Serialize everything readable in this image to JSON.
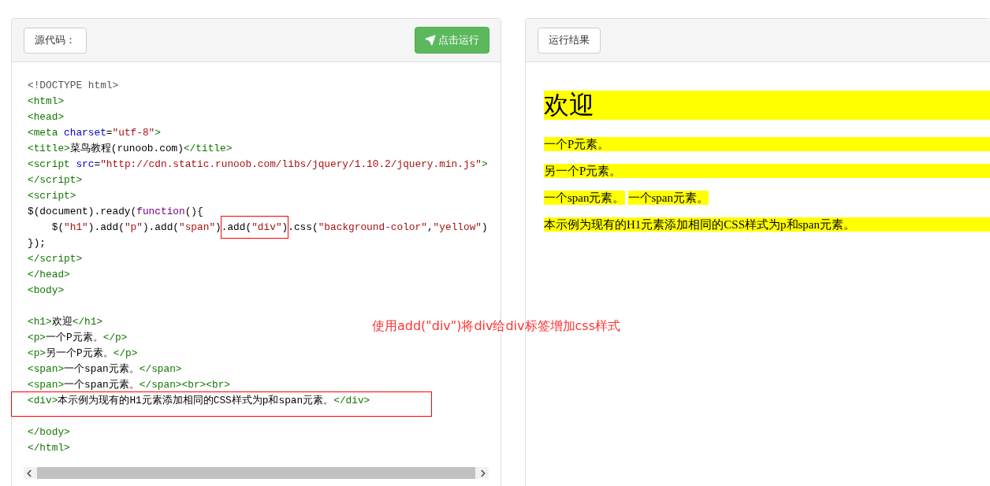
{
  "source_panel": {
    "label": "源代码：",
    "run_button": "点击运行",
    "lines": [
      {
        "kind": "code",
        "tokens": [
          {
            "kind": "meta",
            "text": "<!DOCTYPE html>"
          }
        ]
      },
      {
        "kind": "code",
        "tokens": [
          {
            "kind": "tag",
            "text": "<html>"
          }
        ]
      },
      {
        "kind": "code",
        "tokens": [
          {
            "kind": "tag",
            "text": "<head>"
          }
        ]
      },
      {
        "kind": "code",
        "tokens": [
          {
            "kind": "tag",
            "text": "<meta "
          },
          {
            "kind": "attr",
            "text": "charset"
          },
          {
            "kind": "text",
            "text": "="
          },
          {
            "kind": "string",
            "text": "\"utf-8\""
          },
          {
            "kind": "tag",
            "text": ">"
          }
        ]
      },
      {
        "kind": "code",
        "tokens": [
          {
            "kind": "tag",
            "text": "<title>"
          },
          {
            "kind": "text",
            "text": "菜鸟教程(runoob.com)"
          },
          {
            "kind": "tag",
            "text": "</title>"
          }
        ]
      },
      {
        "kind": "code",
        "tokens": [
          {
            "kind": "tag",
            "text": "<script "
          },
          {
            "kind": "attr",
            "text": "src"
          },
          {
            "kind": "text",
            "text": "="
          },
          {
            "kind": "string",
            "text": "\"http://cdn.static.runoob.com/libs/jquery/1.10.2/jquery.min.js\""
          },
          {
            "kind": "tag",
            "text": ">"
          }
        ]
      },
      {
        "kind": "code",
        "tokens": [
          {
            "kind": "tag",
            "text": "</script>"
          }
        ]
      },
      {
        "kind": "code",
        "tokens": [
          {
            "kind": "tag",
            "text": "<script>"
          }
        ]
      },
      {
        "kind": "code",
        "tokens": [
          {
            "kind": "text",
            "text": "$(document).ready("
          },
          {
            "kind": "keyword",
            "text": "function"
          },
          {
            "kind": "text",
            "text": "(){"
          }
        ]
      },
      {
        "kind": "code",
        "tokens": [
          {
            "kind": "text",
            "text": "    $("
          },
          {
            "kind": "string",
            "text": "\"h1\""
          },
          {
            "kind": "text",
            "text": ").add("
          },
          {
            "kind": "string",
            "text": "\"p\""
          },
          {
            "kind": "text",
            "text": ").add("
          },
          {
            "kind": "string",
            "text": "\"span\""
          },
          {
            "kind": "text",
            "text": ")"
          },
          {
            "kind": "group",
            "boxed": true,
            "tokens": [
              {
                "kind": "text",
                "text": ".add("
              },
              {
                "kind": "string",
                "text": "\"div\""
              },
              {
                "kind": "text",
                "text": ")"
              }
            ]
          },
          {
            "kind": "text",
            "text": ".css("
          },
          {
            "kind": "string",
            "text": "\"background-color\""
          },
          {
            "kind": "text",
            "text": ","
          },
          {
            "kind": "string",
            "text": "\"yellow\""
          },
          {
            "kind": "text",
            "text": ")"
          }
        ]
      },
      {
        "kind": "code",
        "tokens": [
          {
            "kind": "text",
            "text": "});"
          }
        ]
      },
      {
        "kind": "code",
        "tokens": [
          {
            "kind": "tag",
            "text": "</script>"
          }
        ]
      },
      {
        "kind": "code",
        "tokens": [
          {
            "kind": "tag",
            "text": "</head>"
          }
        ]
      },
      {
        "kind": "code",
        "tokens": [
          {
            "kind": "tag",
            "text": "<body>"
          }
        ]
      },
      {
        "kind": "blank"
      },
      {
        "kind": "code",
        "tokens": [
          {
            "kind": "tag",
            "text": "<h1>"
          },
          {
            "kind": "text",
            "text": "欢迎"
          },
          {
            "kind": "tag",
            "text": "</h1>"
          }
        ]
      },
      {
        "kind": "code",
        "tokens": [
          {
            "kind": "tag",
            "text": "<p>"
          },
          {
            "kind": "text",
            "text": "一个P元素。"
          },
          {
            "kind": "tag",
            "text": "</p>"
          }
        ]
      },
      {
        "kind": "code",
        "tokens": [
          {
            "kind": "tag",
            "text": "<p>"
          },
          {
            "kind": "text",
            "text": "另一个P元素。"
          },
          {
            "kind": "tag",
            "text": "</p>"
          }
        ]
      },
      {
        "kind": "code",
        "tokens": [
          {
            "kind": "tag",
            "text": "<span>"
          },
          {
            "kind": "text",
            "text": "一个span元素。"
          },
          {
            "kind": "tag",
            "text": "</span>"
          }
        ]
      },
      {
        "kind": "code",
        "tokens": [
          {
            "kind": "tag",
            "text": "<span>"
          },
          {
            "kind": "text",
            "text": "一个span元素。"
          },
          {
            "kind": "tag",
            "text": "</span><br><br>"
          }
        ]
      },
      {
        "kind": "code",
        "boxed": true,
        "tokens": [
          {
            "kind": "tag",
            "text": "<div>"
          },
          {
            "kind": "text",
            "text": "本示例为现有的H1元素添加相同的CSS样式为p和span元素。"
          },
          {
            "kind": "tag",
            "text": "</div>"
          }
        ]
      },
      {
        "kind": "blank"
      },
      {
        "kind": "code",
        "tokens": [
          {
            "kind": "tag",
            "text": "</body>"
          }
        ]
      },
      {
        "kind": "code",
        "tokens": [
          {
            "kind": "tag",
            "text": "</html>"
          }
        ]
      }
    ]
  },
  "annotation": "使用add(\"div\")将div给div标签增加css样式",
  "result_panel": {
    "label": "运行结果",
    "items": [
      {
        "kind": "h1",
        "highlighted": true,
        "texts": [
          "欢迎"
        ]
      },
      {
        "kind": "p",
        "highlighted": true,
        "texts": [
          "一个P元素。"
        ]
      },
      {
        "kind": "p",
        "highlighted": true,
        "texts": [
          "另一个P元素。"
        ]
      },
      {
        "kind": "spans",
        "highlighted": true,
        "texts": [
          "一个span元素。",
          "一个span元素。"
        ]
      },
      {
        "kind": "div",
        "highlighted": true,
        "texts": [
          "本示例为现有的H1元素添加相同的CSS样式为p和span元素。"
        ]
      }
    ]
  }
}
